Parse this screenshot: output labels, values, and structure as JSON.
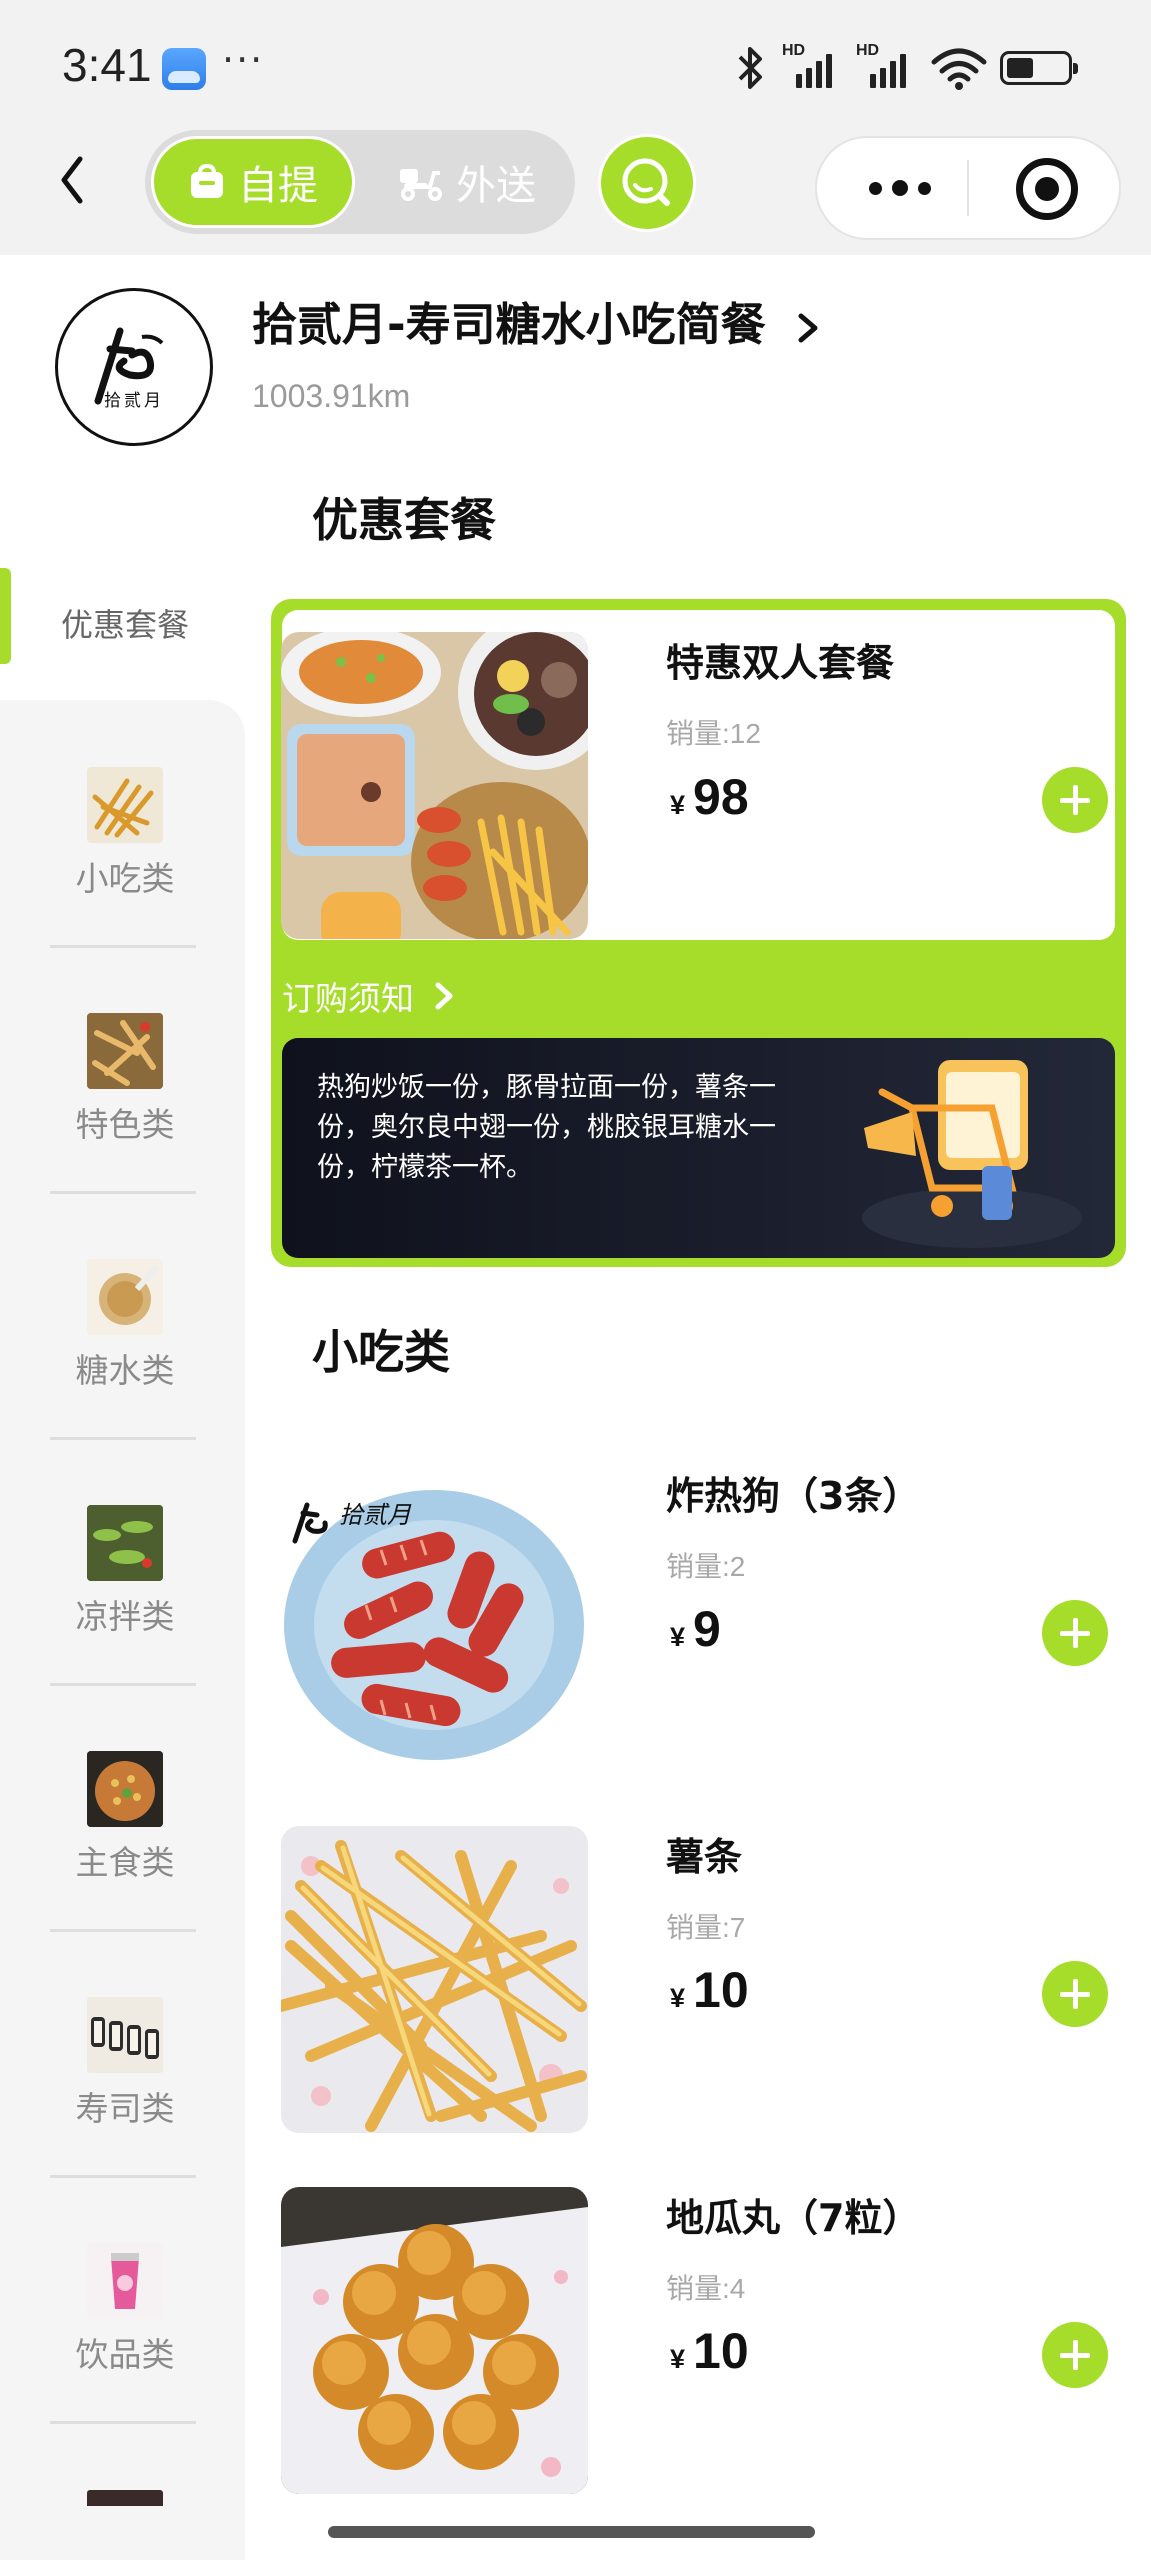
{
  "status_bar": {
    "time": "3:41",
    "dots": "···",
    "net_labels": [
      "HD",
      "HD"
    ]
  },
  "nav": {
    "mode_pickup": "自提",
    "mode_delivery": "外送"
  },
  "store": {
    "name": "拾贰月-寿司糖水小吃简餐",
    "distance": "1003.91km",
    "logo_text": "拾贰月"
  },
  "sidebar": {
    "active": "优惠套餐",
    "items": [
      {
        "label": "小吃类"
      },
      {
        "label": "特色类"
      },
      {
        "label": "糖水类"
      },
      {
        "label": "凉拌类"
      },
      {
        "label": "主食类"
      },
      {
        "label": "寿司类"
      },
      {
        "label": "饮品类"
      }
    ]
  },
  "sections": {
    "combo_title": "优惠套餐",
    "snack_title": "小吃类"
  },
  "combo": {
    "name": "特惠双人套餐",
    "sales": "销量:12",
    "currency": "¥",
    "price": "98",
    "notice": "订购须知",
    "description": "热狗炒饭一份，豚骨拉面一份，薯条一份，奥尔良中翅一份，桃胶银耳糖水一份，柠檬茶一杯。"
  },
  "products": [
    {
      "name": "炸热狗（3条）",
      "sales": "销量:2",
      "currency": "¥",
      "price": "9",
      "watermark": "拾贰月"
    },
    {
      "name": "薯条",
      "sales": "销量:7",
      "currency": "¥",
      "price": "10"
    },
    {
      "name": "地瓜丸（7粒）",
      "sales": "销量:4",
      "currency": "¥",
      "price": "10"
    }
  ],
  "colors": {
    "accent": "#a6dd2a",
    "dark_banner": "#141824"
  }
}
